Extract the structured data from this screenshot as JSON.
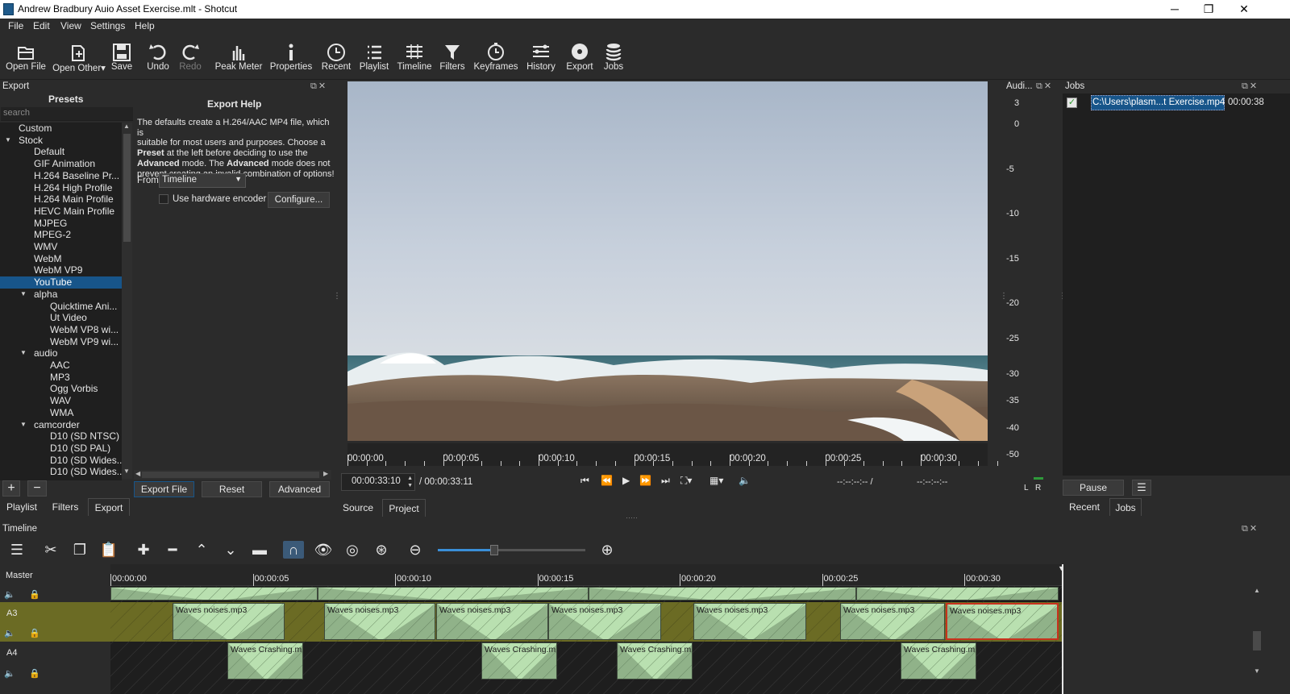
{
  "window": {
    "title": "Andrew Bradbury Auio Asset Exercise.mlt - Shotcut",
    "minimize": "─",
    "maximize": "❐",
    "close": "✕"
  },
  "menu": [
    "File",
    "Edit",
    "View",
    "Settings",
    "Help"
  ],
  "toolbar": [
    {
      "label": "Open File",
      "icon": "open-file-icon"
    },
    {
      "label": "Open Other",
      "icon": "open-other-icon"
    },
    {
      "label": "Save",
      "icon": "save-icon"
    },
    {
      "label": "Undo",
      "icon": "undo-icon"
    },
    {
      "label": "Redo",
      "icon": "redo-icon"
    },
    {
      "label": "Peak Meter",
      "icon": "peak-meter-icon"
    },
    {
      "label": "Properties",
      "icon": "properties-icon"
    },
    {
      "label": "Recent",
      "icon": "recent-icon"
    },
    {
      "label": "Playlist",
      "icon": "playlist-icon"
    },
    {
      "label": "Timeline",
      "icon": "timeline-icon"
    },
    {
      "label": "Filters",
      "icon": "filters-icon"
    },
    {
      "label": "Keyframes",
      "icon": "keyframes-icon"
    },
    {
      "label": "History",
      "icon": "history-icon"
    },
    {
      "label": "Export",
      "icon": "export-icon"
    },
    {
      "label": "Jobs",
      "icon": "jobs-icon"
    }
  ],
  "export_panel": {
    "title": "Export",
    "presets_title": "Presets",
    "search_placeholder": "search",
    "presets": [
      {
        "label": "Custom",
        "level": 1,
        "group": false
      },
      {
        "label": "Stock",
        "level": 0,
        "group": true
      },
      {
        "label": "Default",
        "level": 2
      },
      {
        "label": "GIF Animation",
        "level": 2
      },
      {
        "label": "H.264 Baseline Pr...",
        "level": 2
      },
      {
        "label": "H.264 High Profile",
        "level": 2
      },
      {
        "label": "H.264 Main Profile",
        "level": 2
      },
      {
        "label": "HEVC Main Profile",
        "level": 2
      },
      {
        "label": "MJPEG",
        "level": 2
      },
      {
        "label": "MPEG-2",
        "level": 2
      },
      {
        "label": "WMV",
        "level": 2
      },
      {
        "label": "WebM",
        "level": 2
      },
      {
        "label": "WebM VP9",
        "level": 2
      },
      {
        "label": "YouTube",
        "level": 2,
        "selected": true
      },
      {
        "label": "alpha",
        "level": 1,
        "group": true
      },
      {
        "label": "Quicktime Ani...",
        "level": 3
      },
      {
        "label": "Ut Video",
        "level": 3
      },
      {
        "label": "WebM VP8 wi...",
        "level": 3
      },
      {
        "label": "WebM VP9 wi...",
        "level": 3
      },
      {
        "label": "audio",
        "level": 1,
        "group": true
      },
      {
        "label": "AAC",
        "level": 3
      },
      {
        "label": "MP3",
        "level": 3
      },
      {
        "label": "Ogg Vorbis",
        "level": 3
      },
      {
        "label": "WAV",
        "level": 3
      },
      {
        "label": "WMA",
        "level": 3
      },
      {
        "label": "camcorder",
        "level": 1,
        "group": true
      },
      {
        "label": "D10 (SD NTSC)",
        "level": 3
      },
      {
        "label": "D10 (SD PAL)",
        "level": 3
      },
      {
        "label": "D10 (SD Wides...",
        "level": 3
      },
      {
        "label": "D10 (SD Wides...",
        "level": 3
      }
    ],
    "help_title": "Export Help",
    "help_line1": "The defaults create a H.264/AAC MP4 file, which is",
    "help_line2": "suitable for most users and purposes. Choose a",
    "help_line3a": "Preset",
    "help_line3b": " at the left before deciding to use the",
    "help_line4a": "Advanced",
    "help_line4b": " mode. The ",
    "help_line4c": "Advanced",
    "help_line4d": " mode does not",
    "help_line5": "prevent creating an invalid combination of options!",
    "from_label": "From",
    "from_value": "Timeline",
    "hw_encoder_label": "Use hardware encoder",
    "configure_button": "Configure...",
    "add_button": "+",
    "remove_button": "−",
    "export_file_button": "Export File",
    "reset_button": "Reset",
    "advanced_button": "Advanced",
    "tabs": [
      "Playlist",
      "Filters",
      "Export"
    ]
  },
  "viewer": {
    "ruler_labels": [
      "00:00:00",
      "00:00:05",
      "00:00:10",
      "00:00:15",
      "00:00:20",
      "00:00:25",
      "00:00:30"
    ],
    "timecode": "00:00:33:10",
    "duration": "/ 00:00:33:11",
    "in_point": "--:--:--:-- /",
    "out_point": "--:--:--:--",
    "tabs": [
      "Source",
      "Project"
    ]
  },
  "audio_meter": {
    "title": "Audi...",
    "labels": [
      "3",
      "0",
      "-5",
      "-10",
      "-15",
      "-20",
      "-25",
      "-30",
      "-35",
      "-40",
      "-50"
    ],
    "channels": [
      "L",
      "R"
    ]
  },
  "jobs": {
    "title": "Jobs",
    "job_name": "C:\\Users\\plasm...t Exercise.mp4",
    "job_time": "00:00:38",
    "pause_button": "Pause",
    "tabs": [
      "Recent",
      "Jobs"
    ]
  },
  "timeline": {
    "title": "Timeline",
    "ruler_labels": [
      "00:00:00",
      "00:00:05",
      "00:00:10",
      "00:00:15",
      "00:00:20",
      "00:00:25",
      "00:00:30"
    ],
    "zoom_level": 0.5,
    "tracks": [
      {
        "name": "Master"
      },
      {
        "name": "A3"
      },
      {
        "name": "A4"
      }
    ],
    "a3_clip": "Waves noises.mp3",
    "a4_clip": "Waves Crashing.mp",
    "colors": {
      "clip_green": "#b9e0b0",
      "track_selected": "#6b6b24",
      "selection_border": "#c8321e",
      "accent": "#17558a"
    }
  }
}
